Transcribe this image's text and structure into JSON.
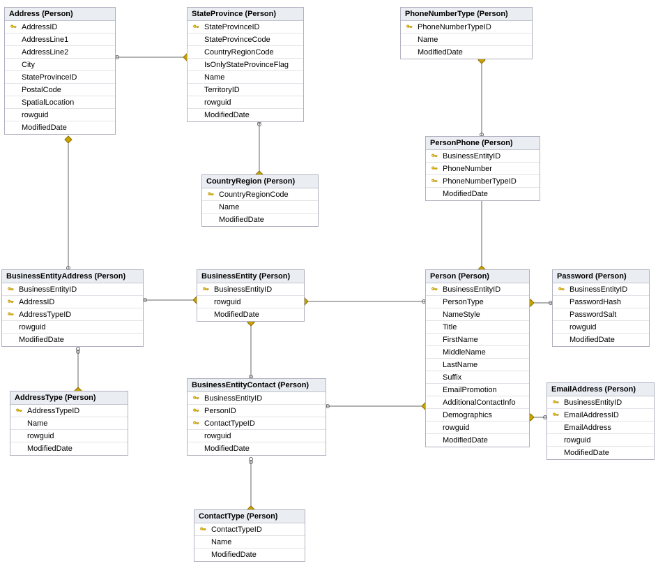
{
  "tables": {
    "address": {
      "title": "Address (Person)",
      "columns": [
        {
          "name": "AddressID",
          "pk": true
        },
        {
          "name": "AddressLine1",
          "pk": false
        },
        {
          "name": "AddressLine2",
          "pk": false
        },
        {
          "name": "City",
          "pk": false
        },
        {
          "name": "StateProvinceID",
          "pk": false
        },
        {
          "name": "PostalCode",
          "pk": false
        },
        {
          "name": "SpatialLocation",
          "pk": false
        },
        {
          "name": "rowguid",
          "pk": false
        },
        {
          "name": "ModifiedDate",
          "pk": false
        }
      ]
    },
    "stateprovince": {
      "title": "StateProvince (Person)",
      "columns": [
        {
          "name": "StateProvinceID",
          "pk": true
        },
        {
          "name": "StateProvinceCode",
          "pk": false
        },
        {
          "name": "CountryRegionCode",
          "pk": false
        },
        {
          "name": "IsOnlyStateProvinceFlag",
          "pk": false
        },
        {
          "name": "Name",
          "pk": false
        },
        {
          "name": "TerritoryID",
          "pk": false
        },
        {
          "name": "rowguid",
          "pk": false
        },
        {
          "name": "ModifiedDate",
          "pk": false
        }
      ]
    },
    "phonenumbertype": {
      "title": "PhoneNumberType (Person)",
      "columns": [
        {
          "name": "PhoneNumberTypeID",
          "pk": true
        },
        {
          "name": "Name",
          "pk": false
        },
        {
          "name": "ModifiedDate",
          "pk": false
        }
      ]
    },
    "personphone": {
      "title": "PersonPhone (Person)",
      "columns": [
        {
          "name": "BusinessEntityID",
          "pk": true
        },
        {
          "name": "PhoneNumber",
          "pk": true
        },
        {
          "name": "PhoneNumberTypeID",
          "pk": true
        },
        {
          "name": "ModifiedDate",
          "pk": false
        }
      ]
    },
    "countryregion": {
      "title": "CountryRegion (Person)",
      "columns": [
        {
          "name": "CountryRegionCode",
          "pk": true
        },
        {
          "name": "Name",
          "pk": false
        },
        {
          "name": "ModifiedDate",
          "pk": false
        }
      ]
    },
    "businessentityaddress": {
      "title": "BusinessEntityAddress (Person)",
      "columns": [
        {
          "name": "BusinessEntityID",
          "pk": true
        },
        {
          "name": "AddressID",
          "pk": true
        },
        {
          "name": "AddressTypeID",
          "pk": true
        },
        {
          "name": "rowguid",
          "pk": false
        },
        {
          "name": "ModifiedDate",
          "pk": false
        }
      ]
    },
    "businessentity": {
      "title": "BusinessEntity (Person)",
      "columns": [
        {
          "name": "BusinessEntityID",
          "pk": true
        },
        {
          "name": "rowguid",
          "pk": false
        },
        {
          "name": "ModifiedDate",
          "pk": false
        }
      ]
    },
    "person": {
      "title": "Person (Person)",
      "columns": [
        {
          "name": "BusinessEntityID",
          "pk": true
        },
        {
          "name": "PersonType",
          "pk": false
        },
        {
          "name": "NameStyle",
          "pk": false
        },
        {
          "name": "Title",
          "pk": false
        },
        {
          "name": "FirstName",
          "pk": false
        },
        {
          "name": "MiddleName",
          "pk": false
        },
        {
          "name": "LastName",
          "pk": false
        },
        {
          "name": "Suffix",
          "pk": false
        },
        {
          "name": "EmailPromotion",
          "pk": false
        },
        {
          "name": "AdditionalContactInfo",
          "pk": false
        },
        {
          "name": "Demographics",
          "pk": false
        },
        {
          "name": "rowguid",
          "pk": false
        },
        {
          "name": "ModifiedDate",
          "pk": false
        }
      ]
    },
    "password": {
      "title": "Password (Person)",
      "columns": [
        {
          "name": "BusinessEntityID",
          "pk": true
        },
        {
          "name": "PasswordHash",
          "pk": false
        },
        {
          "name": "PasswordSalt",
          "pk": false
        },
        {
          "name": "rowguid",
          "pk": false
        },
        {
          "name": "ModifiedDate",
          "pk": false
        }
      ]
    },
    "addresstype": {
      "title": "AddressType (Person)",
      "columns": [
        {
          "name": "AddressTypeID",
          "pk": true
        },
        {
          "name": "Name",
          "pk": false
        },
        {
          "name": "rowguid",
          "pk": false
        },
        {
          "name": "ModifiedDate",
          "pk": false
        }
      ]
    },
    "businessentitycontact": {
      "title": "BusinessEntityContact (Person)",
      "columns": [
        {
          "name": "BusinessEntityID",
          "pk": true
        },
        {
          "name": "PersonID",
          "pk": true
        },
        {
          "name": "ContactTypeID",
          "pk": true
        },
        {
          "name": "rowguid",
          "pk": false
        },
        {
          "name": "ModifiedDate",
          "pk": false
        }
      ]
    },
    "emailaddress": {
      "title": "EmailAddress (Person)",
      "columns": [
        {
          "name": "BusinessEntityID",
          "pk": true
        },
        {
          "name": "EmailAddressID",
          "pk": true
        },
        {
          "name": "EmailAddress",
          "pk": false
        },
        {
          "name": "rowguid",
          "pk": false
        },
        {
          "name": "ModifiedDate",
          "pk": false
        }
      ]
    },
    "contacttype": {
      "title": "ContactType (Person)",
      "columns": [
        {
          "name": "ContactTypeID",
          "pk": true
        },
        {
          "name": "Name",
          "pk": false
        },
        {
          "name": "ModifiedDate",
          "pk": false
        }
      ]
    }
  }
}
